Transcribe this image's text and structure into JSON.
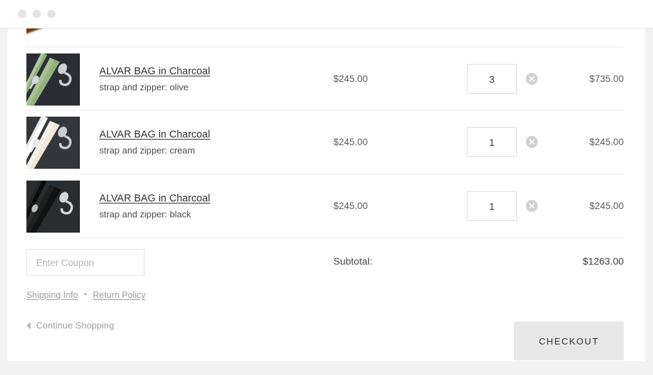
{
  "window": {
    "controls": [
      "close-dot",
      "minimize-dot",
      "maximize-dot"
    ]
  },
  "cart": {
    "rows": [
      {
        "title": "ALVAR BAG in Charcoal",
        "variant": "strap and zipper: olive",
        "unit_price": "$245.00",
        "quantity": "3",
        "line_total": "$735.00",
        "remove_icon": "close-circle-icon",
        "thumb": {
          "name": "product-thumbnail-olive",
          "bg": "#2a2e34",
          "strap": "#93b27f",
          "strap_dark": "#7d9a6b",
          "zipper": "#a8c294",
          "clasp": "#cdd2d6"
        }
      },
      {
        "title": "ALVAR BAG in Charcoal",
        "variant": "strap and zipper: cream",
        "unit_price": "$245.00",
        "quantity": "1",
        "line_total": "$245.00",
        "remove_icon": "close-circle-icon",
        "thumb": {
          "name": "product-thumbnail-cream",
          "bg": "#33363a",
          "strap": "#efe9dc",
          "strap_dark": "#ddd5c4",
          "zipper": "#f6f4ef",
          "clasp": "#c9ced2"
        }
      },
      {
        "title": "ALVAR BAG in Charcoal",
        "variant": "strap and zipper: black",
        "unit_price": "$245.00",
        "quantity": "1",
        "line_total": "$245.00",
        "remove_icon": "close-circle-icon",
        "thumb": {
          "name": "product-thumbnail-black",
          "bg": "#2a2d30",
          "strap": "#121212",
          "strap_dark": "#0a0a0a",
          "zipper": "#1c1c1c",
          "clasp": "#d7d9d7"
        }
      }
    ]
  },
  "summary": {
    "coupon_placeholder": "Enter Coupon",
    "coupon_value": "",
    "subtotal_label": "Subtotal:",
    "subtotal_value": "$1263.00"
  },
  "policy": {
    "shipping_link": "Shipping Info",
    "separator": "•",
    "return_link": "Return Policy"
  },
  "footer": {
    "continue_label": "Continue Shopping",
    "back_icon": "caret-left-icon",
    "checkout_label": "CHECKOUT"
  }
}
